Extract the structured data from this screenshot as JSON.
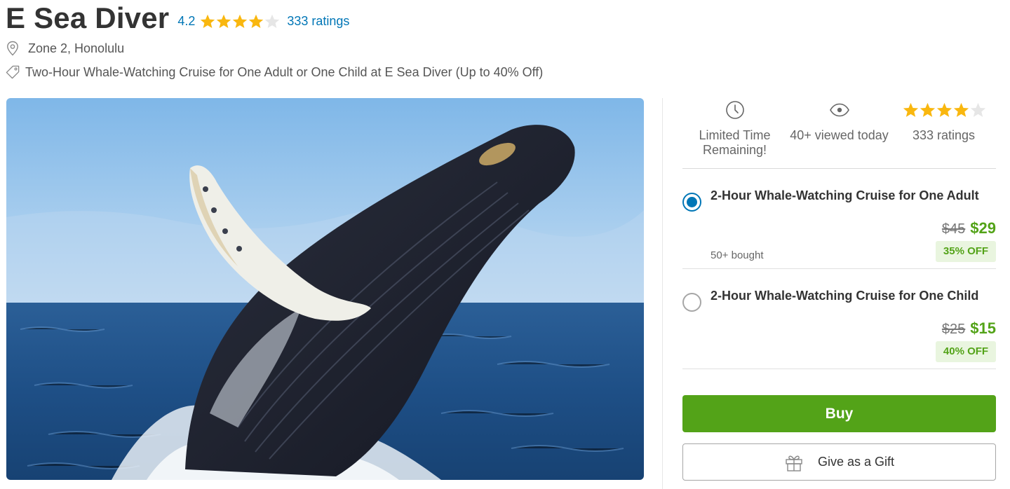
{
  "deal": {
    "title": "E Sea Diver",
    "rating": "4.2",
    "rating_stars": 4.2,
    "ratings_count_label": "333 ratings",
    "location": "Zone 2, Honolulu",
    "tagline": "Two-Hour Whale-Watching Cruise for One Adult or One Child at E Sea Diver (Up to 40% Off)"
  },
  "hero_image": {
    "description_icon": "whale-breach-photo"
  },
  "stats": [
    {
      "icon": "clock-icon",
      "label": "Limited Time Remaining!"
    },
    {
      "icon": "eye-icon",
      "label": "40+ viewed today"
    },
    {
      "icon": "star-rating",
      "label": "333 ratings",
      "stars": 4.2
    }
  ],
  "options": [
    {
      "title": "2-Hour Whale-Watching Cruise for One Adult",
      "original_price": "$45",
      "price": "$29",
      "discount": "35% OFF",
      "bought": "50+ bought",
      "selected": true
    },
    {
      "title": "2-Hour Whale-Watching Cruise for One Child",
      "original_price": "$25",
      "price": "$15",
      "discount": "40% OFF",
      "bought": "",
      "selected": false
    }
  ],
  "actions": {
    "buy_label": "Buy",
    "gift_label": "Give as a Gift"
  },
  "colors": {
    "link_blue": "#0076b6",
    "star_gold": "#f9b70f",
    "star_empty": "#e6e6e6",
    "green": "#53a318",
    "green_badge_bg": "#e9f5df"
  }
}
